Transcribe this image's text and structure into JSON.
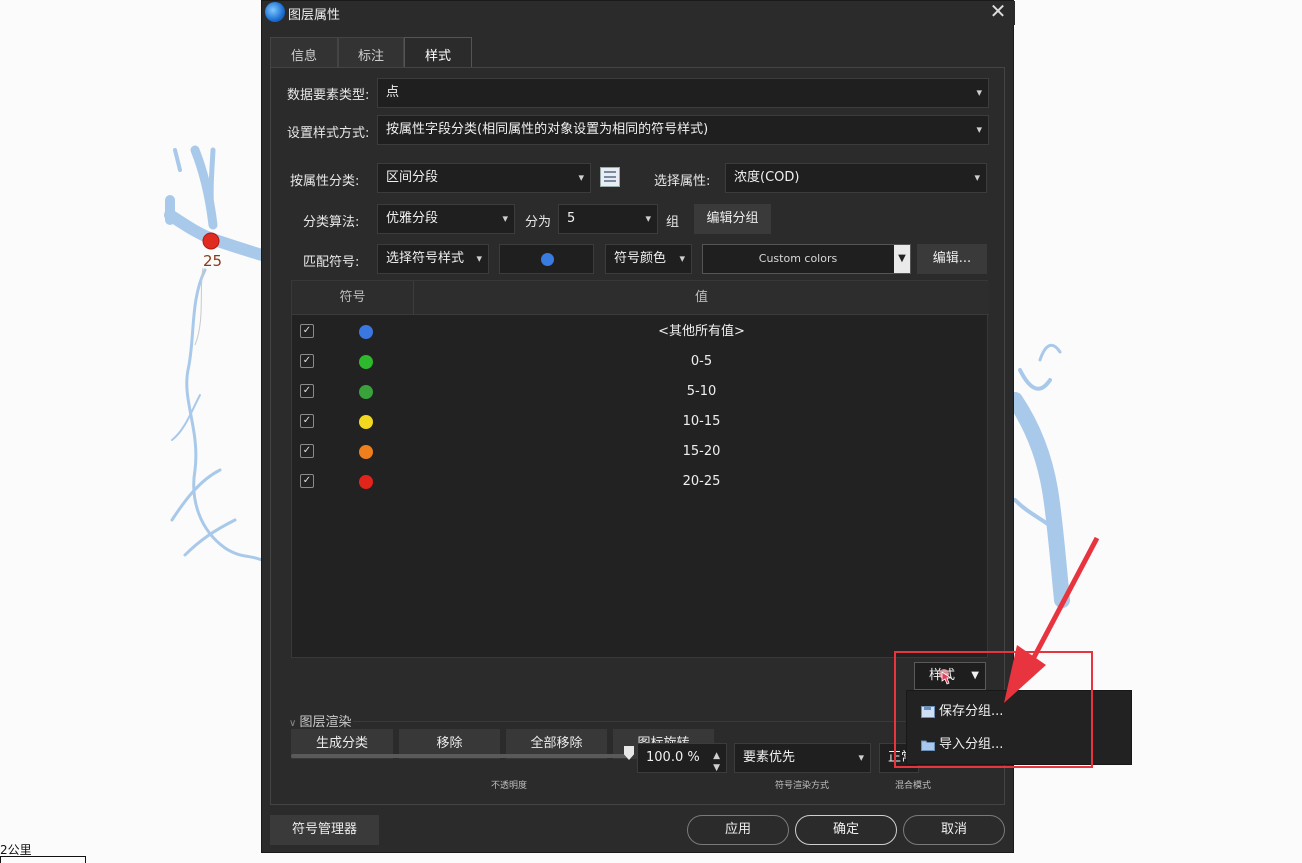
{
  "map": {
    "point_label": "25",
    "point_color": "#e02b20",
    "river_color": "#a9c9ea",
    "scale_label": "2公里"
  },
  "dialog": {
    "title": "图层属性",
    "close_glyph": "✕",
    "tabs": [
      {
        "label": "信息",
        "active": false
      },
      {
        "label": "标注",
        "active": false
      },
      {
        "label": "样式",
        "active": true
      }
    ],
    "feature_type": {
      "label": "数据要素类型:",
      "value": "点"
    },
    "style_method": {
      "label": "设置样式方式:",
      "value": "按属性字段分类(相同属性的对象设置为相同的符号样式)"
    },
    "classify_by": {
      "label": "按属性分类:",
      "value": "区间分段"
    },
    "select_attr": {
      "label": "选择属性:",
      "value": "浓度(COD)"
    },
    "algorithm": {
      "label": "分类算法:",
      "value": "优雅分段"
    },
    "divide_into": {
      "label": "分为",
      "value": "5",
      "unit": "组"
    },
    "edit_groups_label": "编辑分组",
    "match_symbol": {
      "label": "匹配符号:",
      "value": "选择符号样式"
    },
    "symbol_preview_color": "#3a7be0",
    "symbol_color_label": "符号颜色",
    "custom_colors_label": "Custom colors",
    "edit_label": "编辑...",
    "table": {
      "headers": [
        "符号",
        "值"
      ],
      "rows": [
        {
          "checked": true,
          "color": "#3a78e0",
          "value": "<其他所有值>"
        },
        {
          "checked": true,
          "color": "#2db82d",
          "value": "0-5"
        },
        {
          "checked": true,
          "color": "#38a33a",
          "value": "5-10"
        },
        {
          "checked": true,
          "color": "#f2d81f",
          "value": "10-15"
        },
        {
          "checked": true,
          "color": "#f07e1c",
          "value": "15-20"
        },
        {
          "checked": true,
          "color": "#e3241b",
          "value": "20-25"
        }
      ]
    },
    "actions": [
      "生成分类",
      "移除",
      "全部移除",
      "图标旋转"
    ],
    "style_split_label": "样式",
    "render_section": "图层渲染",
    "opacity_value": "100.0 %",
    "render_order": "要素优先",
    "blend_mode": "正常",
    "caption_opacity": "不透明度",
    "caption_render": "符号渲染方式",
    "caption_blend": "混合模式",
    "symbol_manager": "符号管理器",
    "apply": "应用",
    "ok": "确定",
    "cancel": "取消"
  },
  "popup": {
    "items": [
      "保存分组...",
      "导入分组..."
    ]
  },
  "annotation": {
    "highlight_color": "#e8343f"
  }
}
